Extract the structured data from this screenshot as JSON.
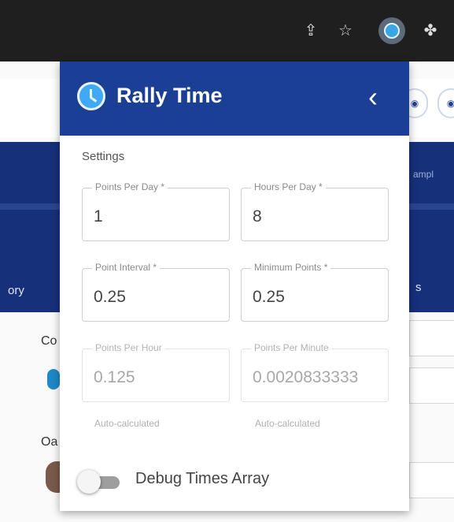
{
  "browser_toolbar": {
    "icons": [
      "share-icon",
      "star-icon",
      "extension-active-icon",
      "puzzle-icon"
    ]
  },
  "background_page": {
    "left_tab_fragment": "ory",
    "right_text_fragment": "ampl",
    "right_band_fragment": "s",
    "labels": [
      "Co",
      "Oa"
    ]
  },
  "popup": {
    "title": "Rally Time",
    "back_glyph": "‹",
    "section_title": "Settings",
    "fields": [
      {
        "label": "Points Per Day *",
        "value": "1",
        "disabled": false
      },
      {
        "label": "Hours Per Day *",
        "value": "8",
        "disabled": false
      },
      {
        "label": "Point Interval *",
        "value": "0.25",
        "disabled": false
      },
      {
        "label": "Minimum Points *",
        "value": "0.25",
        "disabled": false
      },
      {
        "label": "Points Per Hour",
        "value": "0.125",
        "disabled": true
      },
      {
        "label": "Points Per Minute",
        "value": "0.0020833333",
        "disabled": true
      }
    ],
    "helpers": [
      "Auto-calculated",
      "Auto-calculated"
    ],
    "debug_toggle": {
      "label": "Debug Times Array",
      "on": false
    }
  },
  "colors": {
    "header_blue": "#1b3f94",
    "band_blue": "#17307a",
    "logo_blue": "#3fa9f5",
    "toolbar_dark": "#1f1f1f"
  }
}
